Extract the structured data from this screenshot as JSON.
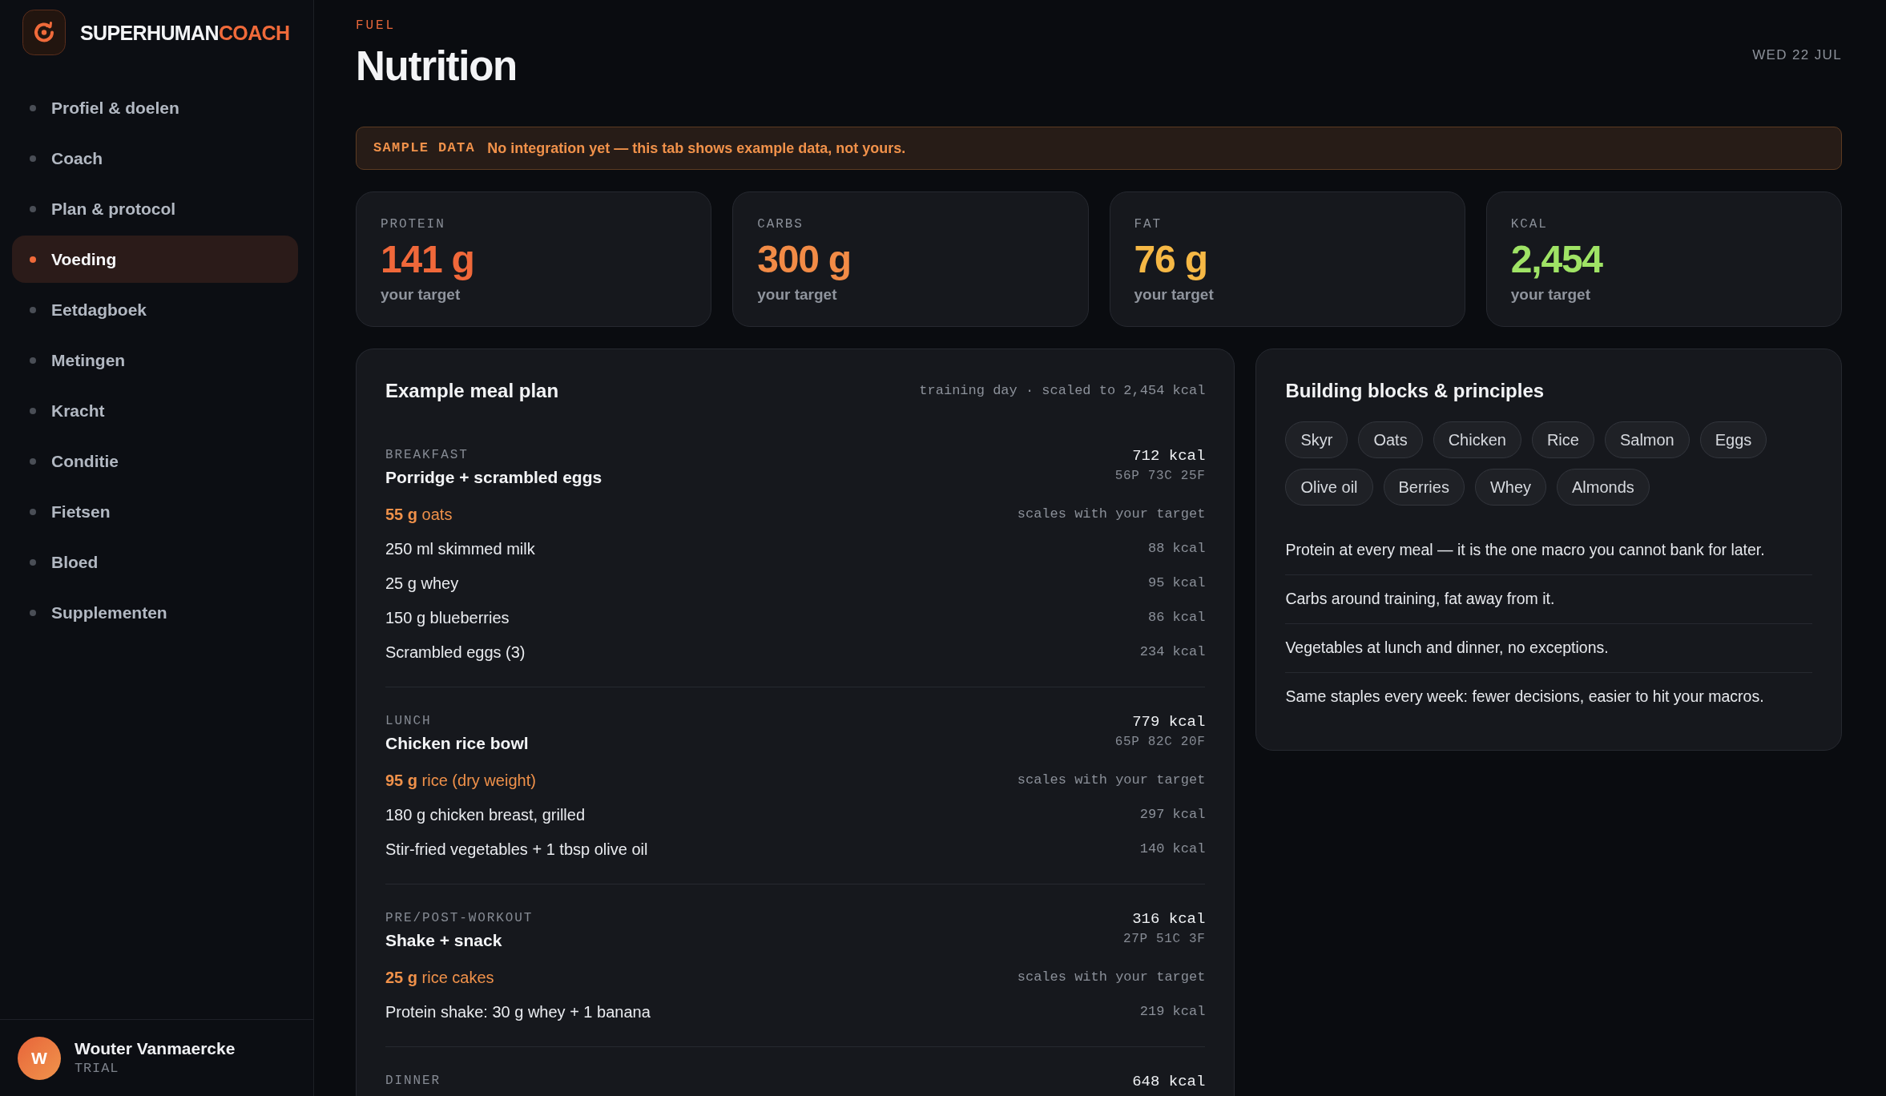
{
  "sidebar": {
    "brand": {
      "name": "SUPERHUMAN",
      "accent": "COACH"
    },
    "items": [
      {
        "label": "Profiel & doelen",
        "selected": false
      },
      {
        "label": "Coach",
        "selected": false
      },
      {
        "label": "Plan & protocol",
        "selected": false
      },
      {
        "label": "Voeding",
        "selected": true
      },
      {
        "label": "Eetdagboek",
        "selected": false
      },
      {
        "label": "Metingen",
        "selected": false
      },
      {
        "label": "Kracht",
        "selected": false
      },
      {
        "label": "Conditie",
        "selected": false
      },
      {
        "label": "Fietsen",
        "selected": false
      },
      {
        "label": "Bloed",
        "selected": false
      },
      {
        "label": "Supplementen",
        "selected": false
      }
    ],
    "user": {
      "initial": "W",
      "name": "Wouter Vanmaercke",
      "plan": "TRIAL"
    }
  },
  "header": {
    "eyebrow": "FUEL",
    "title": "Nutrition",
    "date": "WED 22 JUL"
  },
  "notice": {
    "label": "SAMPLE DATA",
    "message": "No integration yet — this tab shows example data, not yours."
  },
  "stats": [
    {
      "label": "PROTEIN",
      "value": "141 g",
      "caption": "your target",
      "color": "#f0683a"
    },
    {
      "label": "CARBS",
      "value": "300 g",
      "caption": "your target",
      "color": "#f28b46"
    },
    {
      "label": "FAT",
      "value": "76 g",
      "caption": "your target",
      "color": "#f6b845"
    },
    {
      "label": "KCAL",
      "value": "2,454",
      "caption": "your target",
      "color": "#9fe365"
    }
  ],
  "meal_plan": {
    "title": "Example meal plan",
    "meta": "training day · scaled to 2,454 kcal",
    "meals": [
      {
        "label": "BREAKFAST",
        "kcal": "712 kcal",
        "name": "Porridge + scrambled eggs",
        "macros": "56P 73C 25F",
        "items": [
          {
            "kind": "scaled",
            "text": "**55 g** oats",
            "note": "scales with your target"
          },
          {
            "kind": "fixed",
            "text": "250 ml skimmed milk",
            "note": "88 kcal"
          },
          {
            "kind": "fixed",
            "text": "25 g whey",
            "note": "95 kcal"
          },
          {
            "kind": "fixed",
            "text": "150 g blueberries",
            "note": "86 kcal"
          },
          {
            "kind": "fixed",
            "text": "Scrambled eggs (3)",
            "note": "234 kcal"
          }
        ]
      },
      {
        "label": "LUNCH",
        "kcal": "779 kcal",
        "name": "Chicken rice bowl",
        "macros": "65P 82C 20F",
        "items": [
          {
            "kind": "scaled",
            "text": "**95 g** rice (dry weight)",
            "note": "scales with your target"
          },
          {
            "kind": "fixed",
            "text": "180 g chicken breast, grilled",
            "note": "297 kcal"
          },
          {
            "kind": "fixed",
            "text": "Stir-fried vegetables + 1 tbsp olive oil",
            "note": "140 kcal"
          }
        ]
      },
      {
        "label": "PRE/POST-WORKOUT",
        "kcal": "316 kcal",
        "name": "Shake + snack",
        "macros": "27P 51C 3F",
        "items": [
          {
            "kind": "scaled",
            "text": "**25 g** rice cakes",
            "note": "scales with your target"
          },
          {
            "kind": "fixed",
            "text": "Protein shake: 30 g whey + 1 banana",
            "note": "219 kcal"
          }
        ]
      },
      {
        "label": "DINNER",
        "kcal": "648 kcal"
      }
    ]
  },
  "principles_panel": {
    "title": "Building blocks & principles",
    "chips": [
      "Skyr",
      "Oats",
      "Chicken",
      "Rice",
      "Salmon",
      "Eggs",
      "Olive oil",
      "Berries",
      "Whey",
      "Almonds"
    ],
    "principles": [
      "Protein at every meal — it is the one macro you cannot bank for later.",
      "Carbs around training, fat away from it.",
      "Vegetables at lunch and dinner, no exceptions.",
      "Same staples every week: fewer decisions, easier to hit your macros."
    ]
  }
}
